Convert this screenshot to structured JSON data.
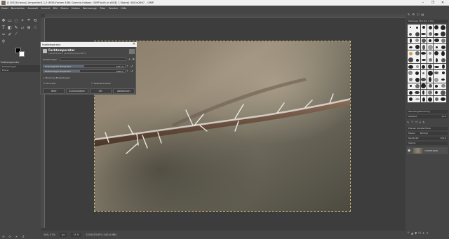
{
  "window": {
    "title": "[120328-hexus] (importiert)-1.0 (RGB-Farben 8-Bit Gamma-Integer, GIMP built-in sRGB, 1 Ebene) 4000x2667 – GIMP",
    "controls": [
      "–",
      "❐",
      "✕"
    ]
  },
  "menu": [
    "Datei",
    "Bearbeiten",
    "Auswahl",
    "Ansicht",
    "Bild",
    "Ebene",
    "Farben",
    "Werkzeuge",
    "Filter",
    "Fenster",
    "Hilfe"
  ],
  "left_panel": {
    "tool_options_title": "Farbtemperatur",
    "tool_options_rows": [
      "Einstellungen",
      "Ebene"
    ],
    "bottom_icons": [
      "⟲",
      "⟳",
      "✕",
      "↺"
    ]
  },
  "dialog": {
    "window_title": "Farbtemperatur",
    "heading": "Farbtemperatur",
    "subheading": "1204033.JPG-1 ([120328] (importiert))",
    "presets_label": "Einstellungen",
    "original_temp": {
      "label": "Ursprüngliche Temperatur",
      "value": "6577.9",
      "fraction": 0.5
    },
    "intended_temp": {
      "label": "Beabsichtigte Temperatur",
      "value": "6000.0",
      "fraction": 0.45
    },
    "blending_label": "Mischung Einstellungen",
    "preview_label": "Vorschau",
    "split_label": "Geteilte Ansicht",
    "buttons": [
      "Hilfe",
      "Zurücksetzen",
      "OK",
      "Abbrechen"
    ]
  },
  "status": {
    "zoom": "100, 27%",
    "unit": "px",
    "percent": "25 %",
    "file": "1204033.JPG (140,4 MB)"
  },
  "right_panel": {
    "tabs": [
      "✎",
      "⚙",
      "☐",
      "▤"
    ],
    "brush_title": "Hardness 050 (51 × 51)",
    "brush_tag": "Werkzeugsammlung",
    "spacing_label": "Abstand",
    "spacing_value": "10.0",
    "layer_tabs": "Ebenen  Kanäle  Pfade",
    "mode_label": "Modus",
    "mode_value": "Normal",
    "opacity_label": "Deckkraft",
    "opacity_value": "100.0",
    "lock_label": "Sperre:",
    "layer_name": "1204033.JPG"
  }
}
